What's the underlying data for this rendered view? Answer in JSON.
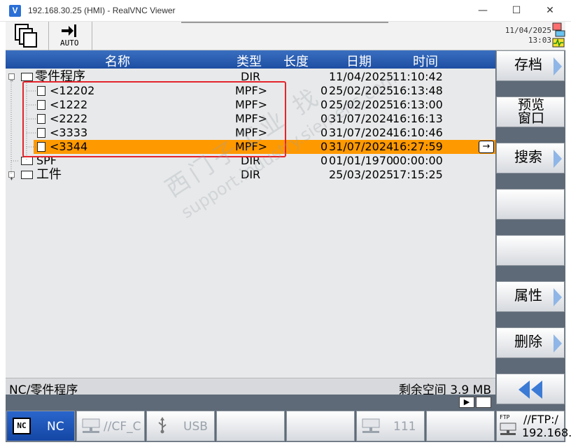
{
  "window": {
    "title": "192.168.30.25 (HMI) - RealVNC Viewer",
    "app_icon": "V",
    "minimize": "—",
    "maximize": "☐",
    "close": "✕"
  },
  "header": {
    "mode_label": "AUTO",
    "date": "11/04/2025",
    "time": "13:03"
  },
  "columns": {
    "name": "名称",
    "type": "类型",
    "length": "长度",
    "date": "日期",
    "time": "时间"
  },
  "rows": [
    {
      "name": "零件程序",
      "type": "DIR",
      "length": "",
      "date": "11/04/2025",
      "time": "11:10:42"
    },
    {
      "name": "<12202",
      "type": "MPF>",
      "length": "0",
      "date": "25/02/2025",
      "time": "16:13:48"
    },
    {
      "name": "<1222",
      "type": "MPF>",
      "length": "0",
      "date": "25/02/2025",
      "time": "16:13:00"
    },
    {
      "name": "<2222",
      "type": "MPF>",
      "length": "0",
      "date": "31/07/2024",
      "time": "16:16:13"
    },
    {
      "name": "<3333",
      "type": "MPF>",
      "length": "0",
      "date": "31/07/2024",
      "time": "16:10:46"
    },
    {
      "name": "<3344",
      "type": "MPF>",
      "length": "0",
      "date": "31/07/2024",
      "time": "16:27:59"
    },
    {
      "name": "SPF",
      "type": "DIR",
      "length": "0",
      "date": "01/01/1970",
      "time": "00:00:00"
    },
    {
      "name": "工件",
      "type": "DIR",
      "length": "",
      "date": "25/03/2025",
      "time": "17:15:25"
    }
  ],
  "selected_arrow": "→",
  "status": {
    "path": "NC/零件程序",
    "free_space": "剩余空间 3.9 MB"
  },
  "scroll": {
    "right": "▶"
  },
  "softkeys": {
    "archive": "存档",
    "preview_line1": "预览",
    "preview_line2": "窗口",
    "search": "搜索",
    "properties": "属性",
    "delete": "删除"
  },
  "bottom_keys": {
    "nc": "NC",
    "nc_icon_text": "NC",
    "cf": "//CF_C",
    "usb": "USB",
    "net": "111",
    "ftp_icon": "FTP",
    "ftp_line1": "//FTP:/",
    "ftp_line2": "192.168."
  },
  "watermark": {
    "line1": "西门子工业  找",
    "line2": "support.industry.siemens.com"
  },
  "colors": {
    "header_blue": "#1d4ea2",
    "selection_orange": "#ff9900",
    "annotation_red": "#e5242b",
    "softkey_panel": "#5e6a77"
  }
}
